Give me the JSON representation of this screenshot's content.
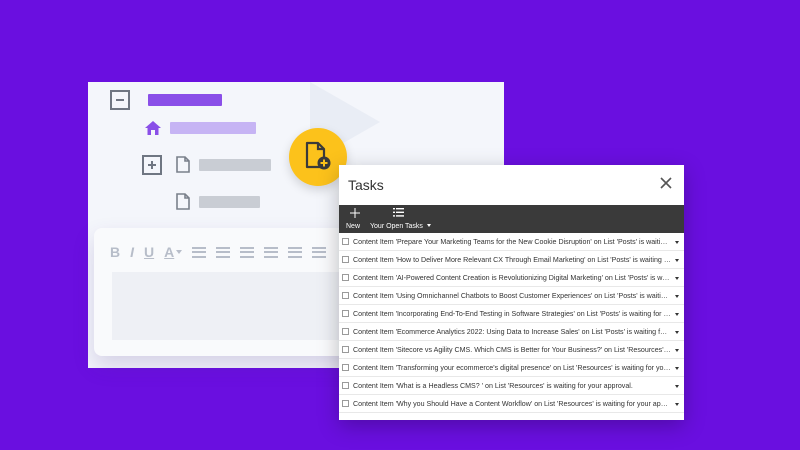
{
  "colors": {
    "background": "#6a0fe0",
    "accent_purple": "#8a4fe8",
    "accent_purple_light": "#b9a0f2",
    "fab_yellow": "#fcc21b",
    "toolbar_dark": "#3a3a3a"
  },
  "icons": {
    "collapse": "minus-square-icon",
    "home": "home-icon",
    "expand": "plus-square-icon",
    "page": "document-icon",
    "fab": "document-add-icon",
    "close": "close-icon",
    "new": "plus-icon",
    "tasks": "list-icon"
  },
  "editor": {
    "bold": "B",
    "italic": "I",
    "underline": "U",
    "font_color": "A"
  },
  "dialog": {
    "title": "Tasks",
    "toolbar": {
      "new_label": "New",
      "open_tasks_label": "Your Open Tasks"
    },
    "tasks": [
      "Content Item 'Prepare Your Marketing Teams for the New Cookie Disruption' on List 'Posts' is waiting for your approval.",
      "Content Item 'How to Deliver More Relevant CX Through Email Marketing' on List 'Posts' is waiting for your approval.",
      "Content Item 'AI-Powered Content Creation is Revolutionizing Digital Marketing' on List 'Posts' is waiting for your approval.",
      "Content Item 'Using Omnichannel Chatbots to Boost Customer Experiences' on List 'Posts' is waiting for your approval.",
      "Content Item 'Incorporating End-To-End Testing in Software Strategies' on List 'Posts' is waiting for your approval.",
      "Content Item 'Ecommerce Analytics 2022: Using Data to Increase Sales' on List 'Posts' is waiting for your approval.",
      "Content Item 'Sitecore vs Agility CMS. Which CMS is Better for Your Business?' on List 'Resources' is waiting for your approval.",
      "Content Item 'Transforming your ecommerce's digital presence' on List 'Resources' is waiting for your approval.",
      "Content Item 'What is a Headless CMS? ' on List 'Resources' is waiting for your approval.",
      "Content Item 'Why you Should Have a Content Workflow' on List 'Resources' is waiting for your approval."
    ]
  }
}
